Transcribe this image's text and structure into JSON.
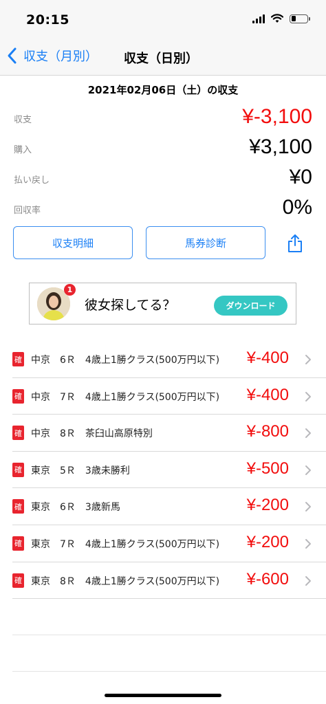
{
  "status_bar": {
    "time": "20:15",
    "battery_level": 0.3
  },
  "nav": {
    "back_label": "収支（月別）",
    "title": "収支（日別）"
  },
  "summary": {
    "date_title": "2021年02月06日（土）の収支",
    "rows": [
      {
        "label": "収支",
        "value": "¥-3,100",
        "color": "#f20d0d"
      },
      {
        "label": "購入",
        "value": "¥3,100",
        "color": "#000000"
      },
      {
        "label": "払い戻し",
        "value": "¥0",
        "color": "#000000"
      },
      {
        "label": "回収率",
        "value": "0%",
        "color": "#000000"
      }
    ]
  },
  "buttons": {
    "detail": "収支明細",
    "diagnosis": "馬券診断",
    "share_icon": "share-icon"
  },
  "ad": {
    "badge": "1",
    "text": "彼女探してる？",
    "cta": "ダウンロード"
  },
  "races": [
    {
      "mark": "確",
      "name": "中京　6Ｒ　4歳上1勝クラス(500万円以下)",
      "amount": "¥-400"
    },
    {
      "mark": "確",
      "name": "中京　7Ｒ　4歳上1勝クラス(500万円以下)",
      "amount": "¥-400"
    },
    {
      "mark": "確",
      "name": "中京　8Ｒ　茶臼山高原特別",
      "amount": "¥-800"
    },
    {
      "mark": "確",
      "name": "東京　5Ｒ　3歳未勝利",
      "amount": "¥-500"
    },
    {
      "mark": "確",
      "name": "東京　6Ｒ　3歳新馬",
      "amount": "¥-200"
    },
    {
      "mark": "確",
      "name": "東京　7Ｒ　4歳上1勝クラス(500万円以下)",
      "amount": "¥-200"
    },
    {
      "mark": "確",
      "name": "東京　8Ｒ　4歳上1勝クラス(500万円以下)",
      "amount": "¥-600"
    }
  ],
  "colors": {
    "accent": "#1a7ff5",
    "negative": "#f20d0d",
    "badge": "#e8242e",
    "cta": "#35c7c3"
  }
}
